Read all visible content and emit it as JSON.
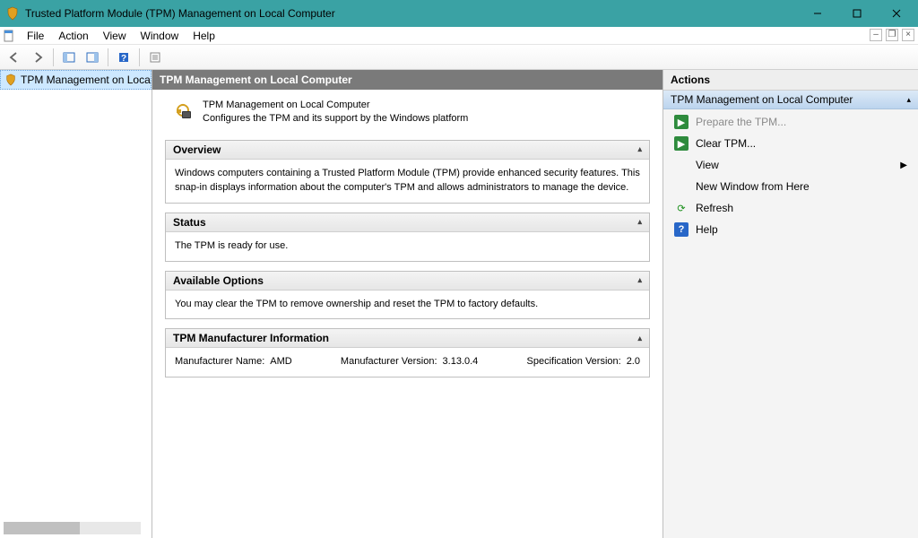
{
  "window": {
    "title": "Trusted Platform Module (TPM) Management on Local Computer"
  },
  "menubar": {
    "file": "File",
    "action": "Action",
    "view": "View",
    "window": "Window",
    "help": "Help"
  },
  "tree": {
    "item0": "TPM Management on Local Comp"
  },
  "content": {
    "header": "TPM Management on Local Computer",
    "desc_title": "TPM Management on Local Computer",
    "desc_sub": "Configures the TPM and its support by the Windows platform",
    "overview_title": "Overview",
    "overview_text": "Windows computers containing a Trusted Platform Module (TPM) provide enhanced security features. This snap-in displays information about the computer's TPM and allows administrators to manage the device.",
    "status_title": "Status",
    "status_text": "The TPM is ready for use.",
    "options_title": "Available Options",
    "options_text": "You may clear the TPM to remove ownership and reset the TPM to factory defaults.",
    "mfg_title": "TPM Manufacturer Information",
    "mfg_name_label": "Manufacturer Name:",
    "mfg_name_value": "AMD",
    "mfg_ver_label": "Manufacturer Version:",
    "mfg_ver_value": "3.13.0.4",
    "spec_ver_label": "Specification Version:",
    "spec_ver_value": "2.0"
  },
  "actions": {
    "title": "Actions",
    "subtitle": "TPM Management on Local Computer",
    "prepare": "Prepare the TPM...",
    "clear": "Clear TPM...",
    "view": "View",
    "newwin": "New Window from Here",
    "refresh": "Refresh",
    "help": "Help"
  }
}
